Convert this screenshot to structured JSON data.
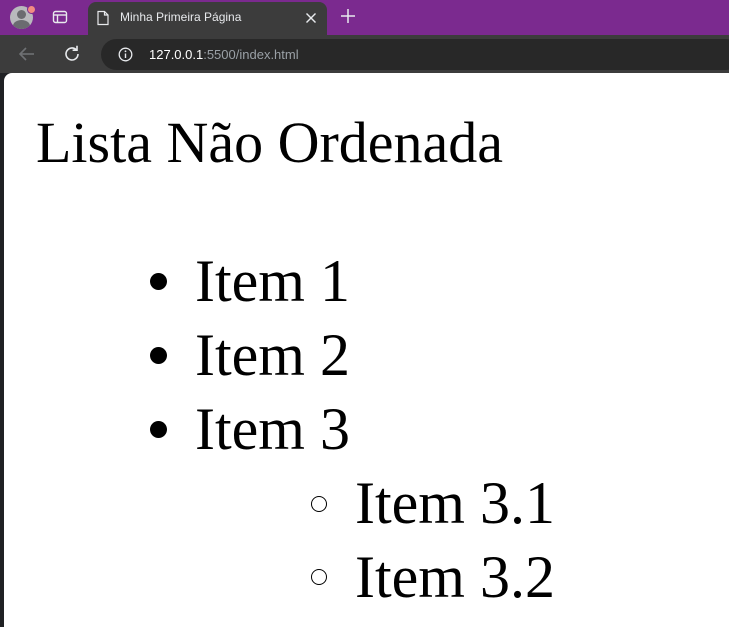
{
  "browser": {
    "tab_title": "Minha Primeira Página",
    "url_host": "127.0.0.1",
    "url_rest": ":5500/index.html"
  },
  "page": {
    "heading": "Lista Não Ordenada",
    "list": [
      {
        "label": "Item 1"
      },
      {
        "label": "Item 2"
      },
      {
        "label": "Item 3",
        "children": [
          {
            "label": "Item 3.1"
          },
          {
            "label": "Item 3.2"
          }
        ]
      }
    ]
  }
}
